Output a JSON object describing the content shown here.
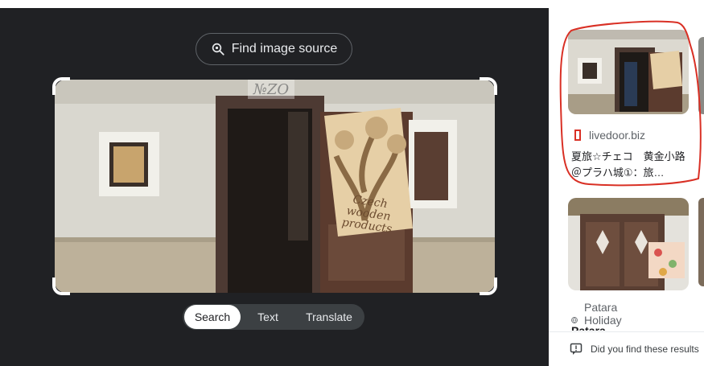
{
  "toolbar": {
    "find_source_label": "Find image source",
    "find_source_icon": "lens-search-icon"
  },
  "image": {
    "watermark": "№ZO",
    "sign_line1": "Czech wooden",
    "sign_line2": "products"
  },
  "modes": {
    "items": [
      {
        "label": "Search",
        "active": true
      },
      {
        "label": "Text",
        "active": false
      },
      {
        "label": "Translate",
        "active": false
      }
    ]
  },
  "results": {
    "items": [
      {
        "site": "livedoor.biz",
        "site_icon": "livedoor-icon",
        "title": "夏旅☆チェコ　黄金小路＠プラハ城①：旅…"
      },
      {
        "site": "Patara Holiday …",
        "site_icon": "globe-icon",
        "title": "Patara Village -"
      }
    ],
    "feedback": "Did you find these results"
  },
  "colors": {
    "viewer_bg": "#202124",
    "annotation": "#d93025"
  }
}
